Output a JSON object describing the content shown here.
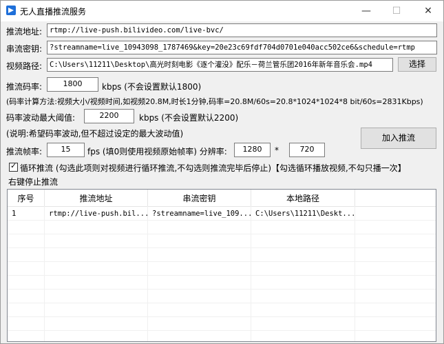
{
  "window": {
    "title": "无人直播推流服务",
    "minimize_glyph": "—",
    "maximize_glyph": "☐",
    "close_glyph": "✕"
  },
  "form": {
    "push_url_label": "推流地址:",
    "push_url_value": "rtmp://live-push.bilivideo.com/live-bvc/",
    "stream_key_label": "串流密钥:",
    "stream_key_value": "?streamname=live_10943098_1787469&key=20e23c69fdf704d0701e040acc502ce6&schedule=rtmp",
    "video_path_label": "视频路径:",
    "video_path_value": "C:\\Users\\11211\\Desktop\\高光时刻电影《逐个灌没》配乐－荷兰管乐团2016年新年音乐会.mp4",
    "browse_button": "选择",
    "bitrate_label": "推流码率:",
    "bitrate_value": "1800",
    "bitrate_unit": "kbps (不会设置默认1800)",
    "bitrate_formula": "(码率计算方法:视频大小/视频时间,如视频20.8M,时长1分钟,码率=20.8M/60s=20.8*1024*1024*8 bit/60s=2831Kbps)",
    "fluct_label": "码率波动最大阈值:",
    "fluct_value": "2200",
    "fluct_unit": "kbps (不会设置默认2200)",
    "fluct_note": "(说明:希望码率波动,但不超过设定的最大波动值)",
    "add_button": "加入推流",
    "fps_label": "推流帧率:",
    "fps_value": "15",
    "fps_unit": "fps (填0则使用视频原始帧率) 分辨率:",
    "res_width": "1280",
    "res_times": "*",
    "res_height": "720",
    "loop_checked": true,
    "loop_check_mark": "✓",
    "loop_label": "循环推流 (勾选此项则对视频进行循环推流,不勾选则推流完毕后停止)【勾选循环播放视频,不勾只播一次】",
    "stop_hint": "右键停止推流"
  },
  "table": {
    "columns": [
      "序号",
      "推流地址",
      "串流密钥",
      "本地路径"
    ],
    "rows": [
      [
        "1",
        "rtmp://live-push.bil...",
        "?streamname=live_109...",
        "C:\\Users\\11211\\Deskt..."
      ]
    ]
  }
}
